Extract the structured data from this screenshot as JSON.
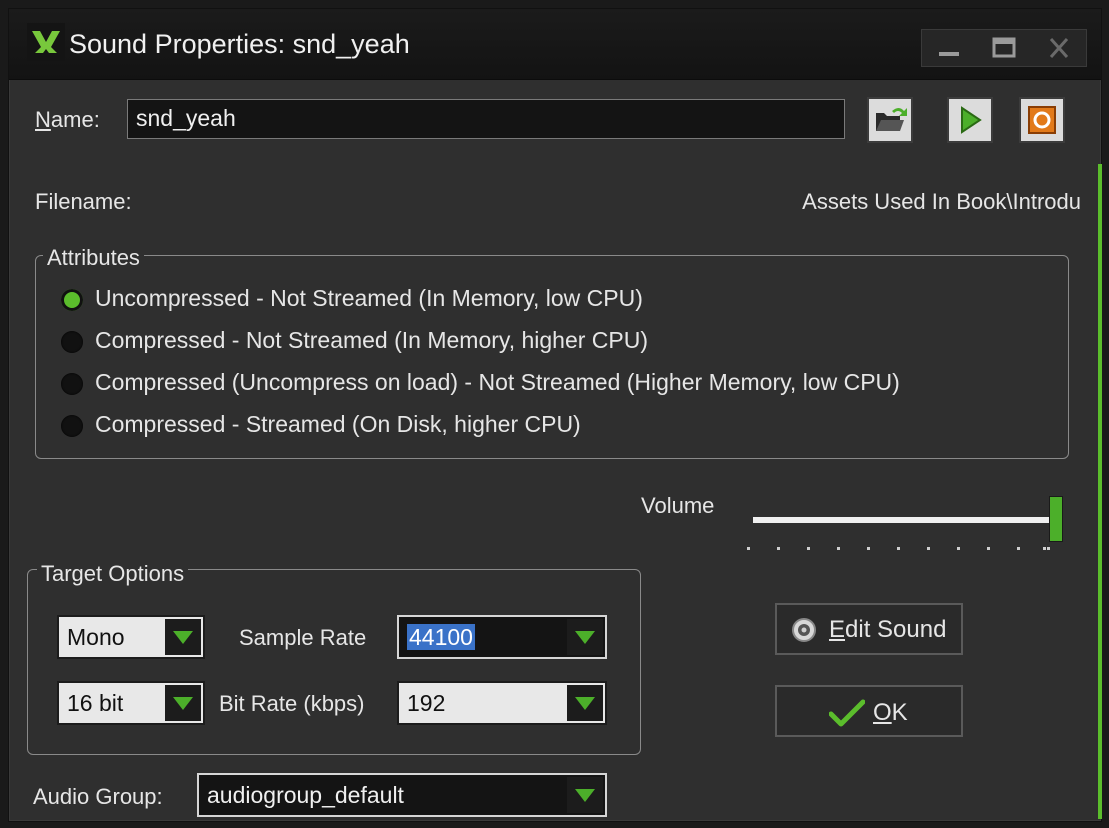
{
  "window": {
    "title": "Sound Properties: snd_yeah",
    "accent": "#5bbd2c"
  },
  "name_row": {
    "label": "Name:",
    "value": "snd_yeah",
    "buttons": [
      {
        "icon": "open-folder-icon"
      },
      {
        "icon": "play-icon"
      },
      {
        "icon": "stop-icon"
      }
    ]
  },
  "filename": {
    "label": "Filename:",
    "value": "Assets Used In Book\\Introdu"
  },
  "attributes": {
    "legend": "Attributes",
    "options": [
      {
        "label": "Uncompressed - Not Streamed (In Memory, low CPU)",
        "selected": true
      },
      {
        "label": "Compressed - Not Streamed (In Memory, higher CPU)",
        "selected": false
      },
      {
        "label": "Compressed (Uncompress on load) - Not Streamed (Higher Memory, low CPU)",
        "selected": false
      },
      {
        "label": "Compressed - Streamed (On Disk, higher CPU)",
        "selected": false
      }
    ]
  },
  "volume": {
    "label": "Volume",
    "level": 1.0
  },
  "target_options": {
    "legend": "Target Options",
    "channels": "Mono",
    "bit_depth": "16 bit",
    "sample_rate_label": "Sample Rate",
    "sample_rate": "44100",
    "bit_rate_label": "Bit Rate (kbps)",
    "bit_rate": "192"
  },
  "audio_group": {
    "label": "Audio Group:",
    "value": "audiogroup_default"
  },
  "actions": {
    "edit_sound": "Edit Sound",
    "ok": "OK"
  }
}
